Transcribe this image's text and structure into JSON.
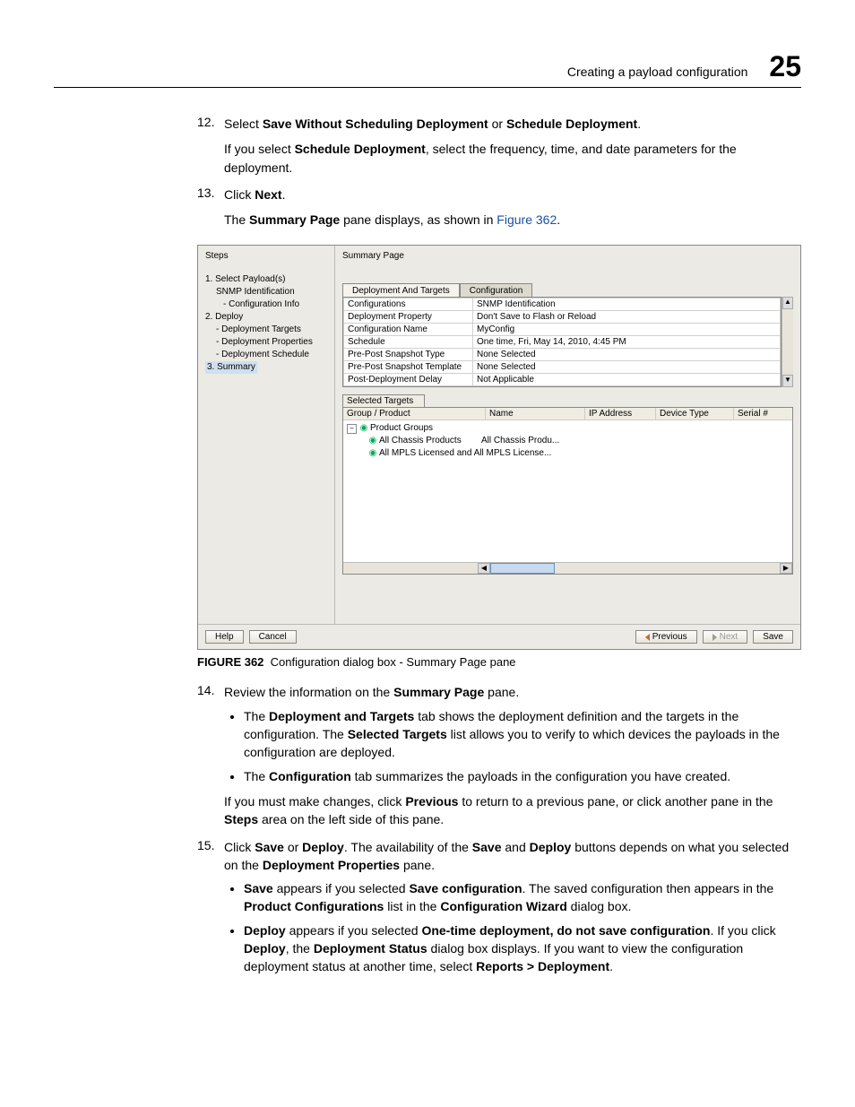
{
  "header": {
    "title": "Creating a payload configuration",
    "chapter": "25"
  },
  "step12": {
    "num": "12.",
    "text_pre": "Select ",
    "opt1": "Save Without Scheduling Deployment",
    "text_or": " or ",
    "opt2": "Schedule Deployment",
    "text_post": ".",
    "note_pre": "If you select ",
    "note_bold": "Schedule Deployment",
    "note_post": ", select the frequency, time, and date parameters for the deployment."
  },
  "step13": {
    "num": "13.",
    "click": "Click ",
    "next": "Next",
    "period": ".",
    "line2_pre": "The ",
    "line2_b": "Summary Page",
    "line2_mid": " pane displays, as shown in ",
    "figref": "Figure 362",
    "line2_post": "."
  },
  "dialog": {
    "steps_label": "Steps",
    "summary_label": "Summary Page",
    "steps": {
      "s1": "1. Select Payload(s)",
      "s1a": "SNMP Identification",
      "s1b": "- Configuration Info",
      "s2": "2. Deploy",
      "s2a": "- Deployment Targets",
      "s2b": "- Deployment Properties",
      "s2c": "- Deployment Schedule",
      "s3": "3. Summary"
    },
    "tabs": {
      "t1": "Deployment And Targets",
      "t2": "Configuration"
    },
    "rows": {
      "r1k": "Configurations",
      "r1v": "SNMP Identification",
      "r2k": "Deployment Property",
      "r2v": "Don't Save to Flash or Reload",
      "r3k": "Configuration Name",
      "r3v": "MyConfig",
      "r4k": "Schedule",
      "r4v": "One time, Fri, May 14, 2010, 4:45 PM",
      "r5k": "Pre-Post Snapshot Type",
      "r5v": "None Selected",
      "r6k": "Pre-Post Snapshot Template",
      "r6v": "None Selected",
      "r7k": "Post-Deployment Delay",
      "r7v": "Not Applicable"
    },
    "sel_targets": "Selected Targets",
    "cols": {
      "group": "Group / Product",
      "name": "Name",
      "ip": "IP Address",
      "type": "Device Type",
      "serial": "Serial #"
    },
    "tree": {
      "root": "Product Groups",
      "n1": "All Chassis Products",
      "n1v": "All Chassis Produ...",
      "n2": "All MPLS Licensed and All MPLS License..."
    },
    "buttons": {
      "help": "Help",
      "cancel": "Cancel",
      "prev": "Previous",
      "next": "Next",
      "save": "Save"
    }
  },
  "fig_caption": {
    "label": "FIGURE 362",
    "text": "Configuration dialog box - Summary Page pane"
  },
  "step14": {
    "num": "14.",
    "pre": "Review the information on the ",
    "b": "Summary Page",
    "post": " pane.",
    "bullet1_pre": "The ",
    "bullet1_b1": "Deployment and Targets",
    "bullet1_mid1": " tab shows the deployment definition and the targets in the configuration. The ",
    "bullet1_b2": "Selected Targets",
    "bullet1_post": " list allows you to verify to which devices the payloads in the configuration are deployed.",
    "bullet2_pre": "The ",
    "bullet2_b": "Configuration",
    "bullet2_post": " tab summarizes the payloads in the configuration you have created.",
    "tail_pre": "If you must make changes, click ",
    "tail_b1": "Previous",
    "tail_mid": " to return to a previous pane, or click another pane in the ",
    "tail_b2": "Steps",
    "tail_post": " area on the left side of this pane."
  },
  "step15": {
    "num": "15.",
    "pre": "Click ",
    "b1": "Save",
    "or": " or ",
    "b2": "Deploy",
    "mid1": ". The availability of the ",
    "b3": "Save",
    "and": " and ",
    "b4": "Deploy",
    "mid2": " buttons depends on what you selected on the ",
    "b5": "Deployment Properties",
    "post": " pane.",
    "bl1_b1": "Save",
    "bl1_t1": " appears if you selected ",
    "bl1_b2": "Save configuration",
    "bl1_t2": ". The saved configuration then appears in the ",
    "bl1_b3": "Product Configurations",
    "bl1_t3": " list in the ",
    "bl1_b4": "Configuration Wizard",
    "bl1_t4": " dialog box.",
    "bl2_b1": "Deploy",
    "bl2_t1": " appears if you selected ",
    "bl2_b2": "One-time deployment, do not save configuration",
    "bl2_t2": ". If you click ",
    "bl2_b3": "Deploy",
    "bl2_t3": ", the ",
    "bl2_b4": "Deployment Status",
    "bl2_t4": " dialog box displays. If you want to view the configuration deployment status at another time, select ",
    "bl2_b5": "Reports > Deployment",
    "bl2_t5": "."
  }
}
